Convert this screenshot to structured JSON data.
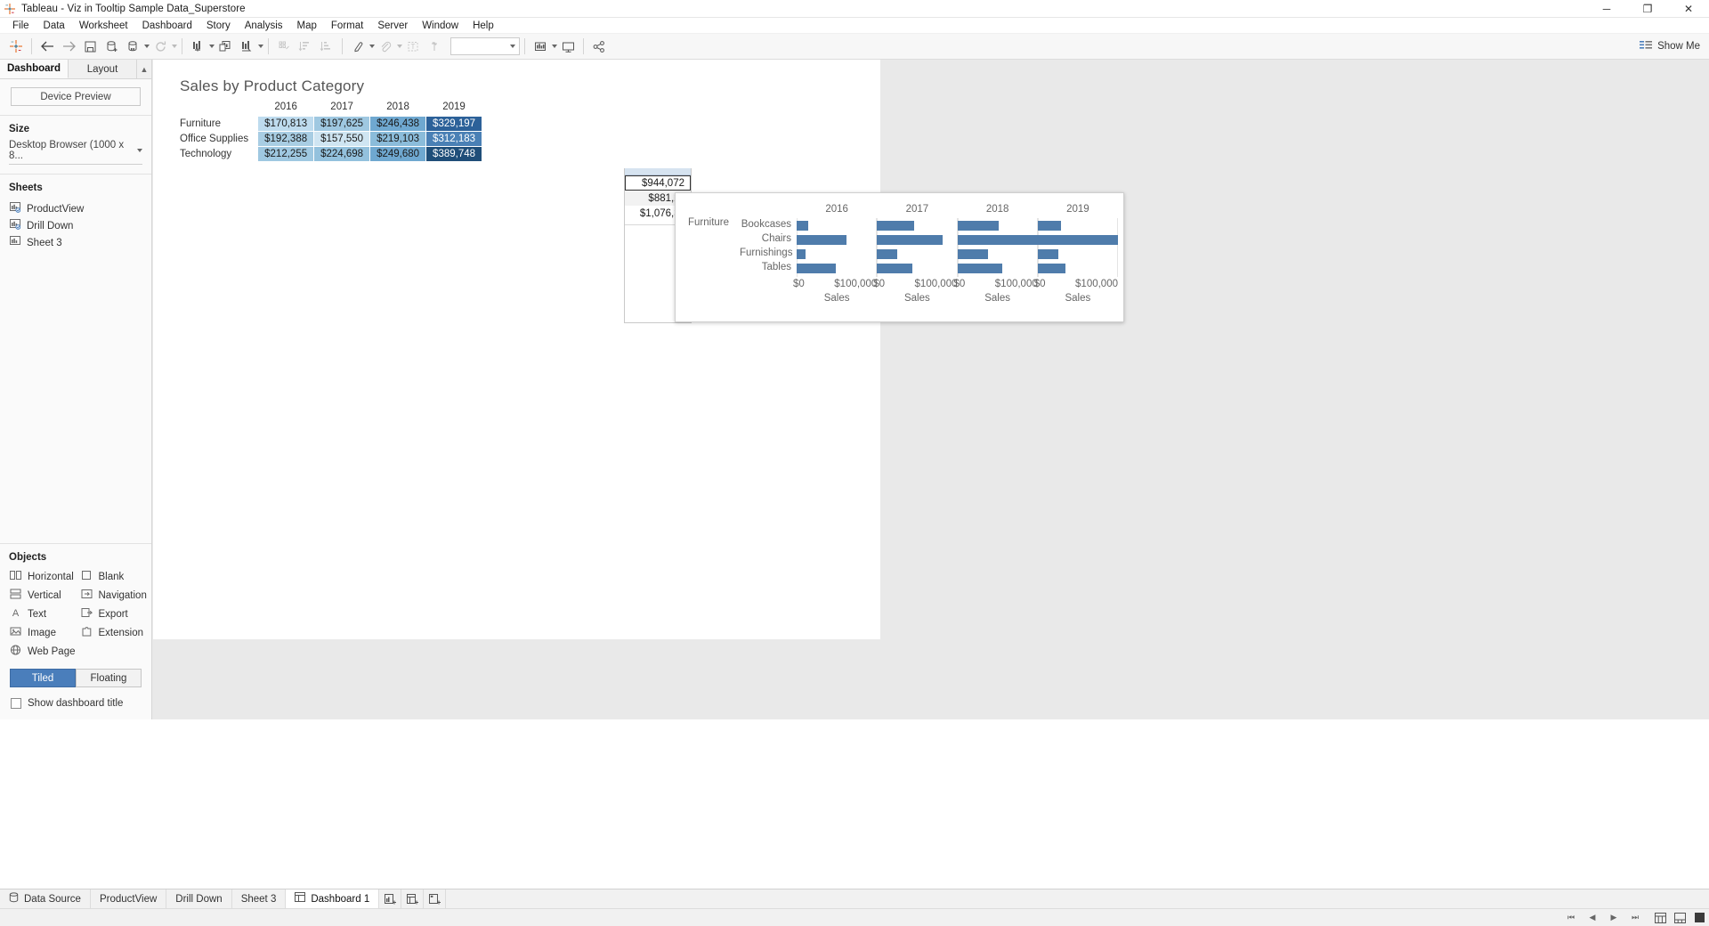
{
  "window": {
    "title": "Tableau - Viz in Tooltip Sample Data_Superstore",
    "logo_icon": "tableau-logo-icon",
    "minimize_label": "─",
    "maximize_label": "❐",
    "close_label": "✕"
  },
  "menubar": {
    "items": [
      "File",
      "Data",
      "Worksheet",
      "Dashboard",
      "Story",
      "Analysis",
      "Map",
      "Format",
      "Server",
      "Window",
      "Help"
    ]
  },
  "toolbar": {
    "show_me_label": "Show Me",
    "combo_value": "",
    "buttons": [
      "tableau-home-icon",
      "back-icon",
      "forward-icon",
      "save-icon",
      "new-data-source-icon",
      "new-worksheet-icon",
      "refresh-icon",
      "clear-sheet-icon",
      "duplicate-icon",
      "swap-rows-columns-icon",
      "sort-ascending-icon",
      "sort-descending-icon",
      "highlight-icon",
      "group-members-icon",
      "show-labels-icon",
      "fix-axes-icon",
      "presentation-mode-icon",
      "fit-selector-icon",
      "share-icon"
    ]
  },
  "left_panel": {
    "tabs": [
      {
        "label": "Dashboard",
        "active": true
      },
      {
        "label": "Layout",
        "active": false
      }
    ],
    "sort_icon": "sort-toggle-icon",
    "device_preview_label": "Device Preview",
    "size": {
      "heading": "Size",
      "value": "Desktop Browser (1000 x 8...",
      "dropdown_icon": "chevron-down-icon"
    },
    "sheets": {
      "heading": "Sheets",
      "items": [
        {
          "label": "ProductView",
          "icon": "worksheet-icon"
        },
        {
          "label": "Drill Down",
          "icon": "worksheet-icon"
        },
        {
          "label": "Sheet 3",
          "icon": "worksheet-icon"
        }
      ]
    },
    "objects": {
      "heading": "Objects",
      "items": [
        {
          "label": "Horizontal",
          "icon": "horizontal-container-icon"
        },
        {
          "label": "Blank",
          "icon": "blank-object-icon"
        },
        {
          "label": "Vertical",
          "icon": "vertical-container-icon"
        },
        {
          "label": "Navigation",
          "icon": "navigation-object-icon"
        },
        {
          "label": "Text",
          "icon": "text-object-icon"
        },
        {
          "label": "Export",
          "icon": "export-object-icon"
        },
        {
          "label": "Image",
          "icon": "image-object-icon"
        },
        {
          "label": "Extension",
          "icon": "extension-object-icon"
        },
        {
          "label": "Web Page",
          "icon": "web-page-object-icon"
        }
      ]
    },
    "tiled_floating": {
      "tiled_label": "Tiled",
      "floating_label": "Floating",
      "selected": "Tiled"
    },
    "show_dashboard_title": {
      "label": "Show dashboard title",
      "checked": false
    }
  },
  "dashboard": {
    "title": "Sales by Product Category"
  },
  "chart_data": {
    "type": "table",
    "title": "Sales by Product Category",
    "categories": [
      "2016",
      "2017",
      "2018",
      "2019"
    ],
    "rows": [
      {
        "label": "Furniture",
        "values": [
          "$170,813",
          "$197,625",
          "$246,438",
          "$329,197"
        ],
        "colors": [
          "#bedbee",
          "#9fc8e1",
          "#6fa8d0",
          "#2c6199"
        ],
        "text_light": [
          false,
          false,
          false,
          true
        ]
      },
      {
        "label": "Office Supplies",
        "values": [
          "$192,388",
          "$157,550",
          "$219,103",
          "$312,183"
        ],
        "colors": [
          "#a8cde3",
          "#cfe5f2",
          "#8bbcda",
          "#4a80b5"
        ],
        "text_light": [
          false,
          false,
          false,
          true
        ]
      },
      {
        "label": "Technology",
        "values": [
          "$212,255",
          "$224,698",
          "$249,680",
          "$389,748"
        ],
        "colors": [
          "#9fc8e1",
          "#93c1dd",
          "#6fa8d0",
          "#1f4e79"
        ],
        "text_light": [
          false,
          false,
          false,
          true
        ]
      }
    ],
    "grand_total": {
      "values": [
        "$944,072",
        "$881,22",
        "$1,076,38"
      ],
      "selected_index": 0
    }
  },
  "tooltip_viz": {
    "type": "bar",
    "row_group_label": "Furniture",
    "subcategories": [
      "Bookcases",
      "Chairs",
      "Furnishings",
      "Tables"
    ],
    "panels": [
      {
        "year": "2016",
        "axis_min_label": "$0",
        "axis_max_label": "$100,000",
        "axis_title": "Sales",
        "values": [
          14000,
          62000,
          11000,
          49000
        ]
      },
      {
        "year": "2017",
        "axis_min_label": "$0",
        "axis_max_label": "$100,000",
        "axis_title": "Sales",
        "values": [
          46000,
          82000,
          25000,
          44000
        ]
      },
      {
        "year": "2018",
        "axis_min_label": "$0",
        "axis_max_label": "$100,000",
        "axis_title": "Sales",
        "values": [
          52000,
          100000,
          38000,
          56000
        ]
      },
      {
        "year": "2019",
        "axis_min_label": "$0",
        "axis_max_label": "$100,000",
        "axis_title": "Sales",
        "values": [
          29000,
          196000,
          26000,
          35000
        ]
      }
    ],
    "axis_scale_max": 100000,
    "bar_color": "#4f7cab"
  },
  "bottom_tabs": {
    "data_source_label": "Data Source",
    "data_source_icon": "data-source-icon",
    "tabs": [
      {
        "label": "ProductView",
        "active": false
      },
      {
        "label": "Drill Down",
        "active": false
      },
      {
        "label": "Sheet 3",
        "active": false
      },
      {
        "label": "Dashboard 1",
        "active": true,
        "icon": "dashboard-icon"
      }
    ],
    "new_buttons": [
      {
        "icon": "new-worksheet-icon"
      },
      {
        "icon": "new-dashboard-icon"
      },
      {
        "icon": "new-story-icon"
      }
    ]
  },
  "status_bar": {
    "nav": {
      "first_icon": "nav-first-icon",
      "prev_icon": "nav-prev-icon",
      "next_icon": "nav-next-icon",
      "last_icon": "nav-last-icon"
    },
    "view_icons": [
      "show-cards-icon",
      "show-filmstrip-icon",
      "show-sheet-sorter-icon"
    ]
  },
  "colors": {
    "accent": "#4a7ebb",
    "bar": "#4f7cab",
    "panel_bg": "#fafafa",
    "canvas_bg": "#e9e9e9"
  }
}
